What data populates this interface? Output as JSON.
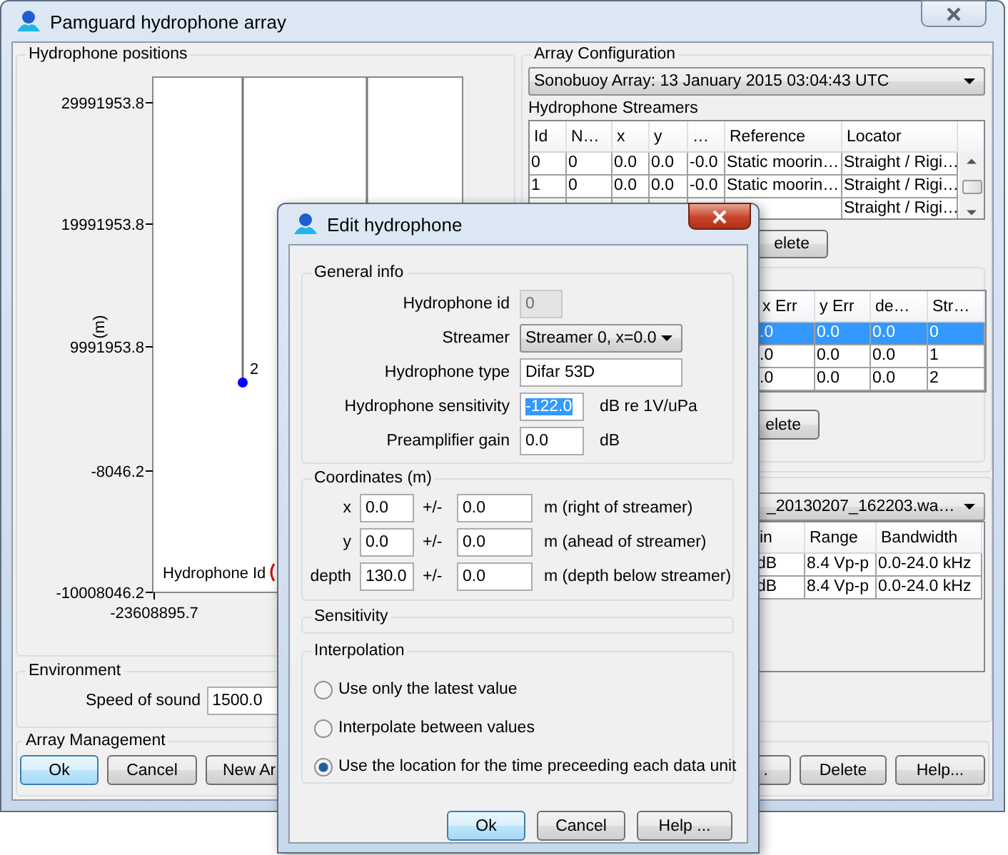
{
  "window": {
    "title": "Pamguard hydrophone array"
  },
  "positions": {
    "title": "Hydrophone positions",
    "y_label": "(m)",
    "y_ticks": [
      "29991953.8",
      "19991953.8",
      "9991953.8",
      "-8046.2",
      "-10008046.2"
    ],
    "x_tick": "-23608895.7",
    "point_label": "2",
    "legend": "Hydrophone Id"
  },
  "environment": {
    "title": "Environment",
    "label": "Speed of sound",
    "value": "1500.0"
  },
  "configuration": {
    "title": "Array Configuration",
    "array": "Sonobuoy Array: 13 January 2015 03:04:43 UTC",
    "streamers_title": "Hydrophone Streamers",
    "streamer_columns": [
      "Id",
      "N…",
      "x",
      "y",
      "…",
      "Reference",
      "Locator"
    ],
    "streamer_rows": [
      {
        "cells": [
          "0",
          "0",
          "0.0",
          "0.0",
          "-0.0",
          "Static moorin…",
          "Straight / Rigi…"
        ]
      },
      {
        "cells": [
          "1",
          "0",
          "0.0",
          "0.0",
          "-0.0",
          "Static moorin…",
          "Straight / Rigi…"
        ]
      },
      {
        "cells": [
          null,
          null,
          null,
          null,
          null,
          null,
          "Straight / Rigi…"
        ]
      }
    ],
    "delete": "elete",
    "elements": {
      "columns": [
        "x Err",
        "y Err",
        "de…",
        "Str…"
      ],
      "rows": [
        {
          "selected": true,
          "cells": [
            ".0",
            "0.0",
            "0.0",
            "0"
          ]
        },
        {
          "selected": false,
          "cells": [
            ".0",
            "0.0",
            "0.0",
            "1"
          ]
        },
        {
          "selected": false,
          "cells": [
            ".0",
            "0.0",
            "0.0",
            "2"
          ]
        }
      ],
      "delete": "elete"
    }
  },
  "acquisition": {
    "file": "_20130207_162203.wa…",
    "columns": [
      "in",
      "Range",
      "Bandwidth"
    ],
    "rows": [
      [
        "dB",
        "8.4 Vp-p",
        "0.0-24.0 kHz"
      ],
      [
        "dB",
        "8.4 Vp-p",
        "0.0-24.0 kHz"
      ]
    ]
  },
  "management": {
    "title": "Array Management",
    "left_buttons": [
      {
        "label": "Ok",
        "default": true
      },
      {
        "label": "Cancel",
        "default": false
      },
      {
        "label": "New Ar",
        "default": false
      }
    ],
    "right_buttons": [
      {
        "label": ".",
        "default": false
      },
      {
        "label": "Delete",
        "default": false
      },
      {
        "label": "Help...",
        "default": false
      }
    ]
  },
  "dialog": {
    "title": "Edit hydrophone",
    "general": {
      "title": "General info",
      "rows": [
        {
          "label": "Hydrophone id",
          "kind": "field",
          "value": "0",
          "disabled": true,
          "highlighted": false
        },
        {
          "label": "Streamer",
          "kind": "dropdown",
          "value": "Streamer 0, x=0.0",
          "disabled": false,
          "highlighted": false
        },
        {
          "label": "Hydrophone type",
          "kind": "field",
          "value": "Difar 53D",
          "disabled": false,
          "highlighted": false
        },
        {
          "label": "Hydrophone sensitivity",
          "kind": "field",
          "value": "-122.0",
          "unit": "dB re 1V/uPa",
          "disabled": false,
          "highlighted": true
        },
        {
          "label": "Preamplifier gain",
          "kind": "field",
          "value": "0.0",
          "unit": "dB",
          "disabled": false,
          "highlighted": false
        }
      ]
    },
    "coordinates": {
      "title": "Coordinates (m)",
      "rows": [
        {
          "label": "x",
          "value": "0.0",
          "pm": "+/-",
          "error": "0.0",
          "unit": "m (right of streamer)"
        },
        {
          "label": "y",
          "value": "0.0",
          "pm": "+/-",
          "error": "0.0",
          "unit": "m (ahead of streamer)"
        },
        {
          "label": "depth",
          "value": "130.0",
          "pm": "+/-",
          "error": "0.0",
          "unit": "m (depth below streamer)"
        }
      ]
    },
    "sensitivity": {
      "title": "Sensitivity"
    },
    "interpolation": {
      "title": "Interpolation",
      "options": [
        {
          "label": "Use only the latest value",
          "selected": false
        },
        {
          "label": "Interpolate between values",
          "selected": false
        },
        {
          "label": "Use the location for the time preceeding each data unit",
          "selected": true
        }
      ]
    },
    "buttons": [
      {
        "label": "Ok",
        "default": true
      },
      {
        "label": "Cancel",
        "default": false
      },
      {
        "label": "Help ...",
        "default": false
      }
    ]
  }
}
